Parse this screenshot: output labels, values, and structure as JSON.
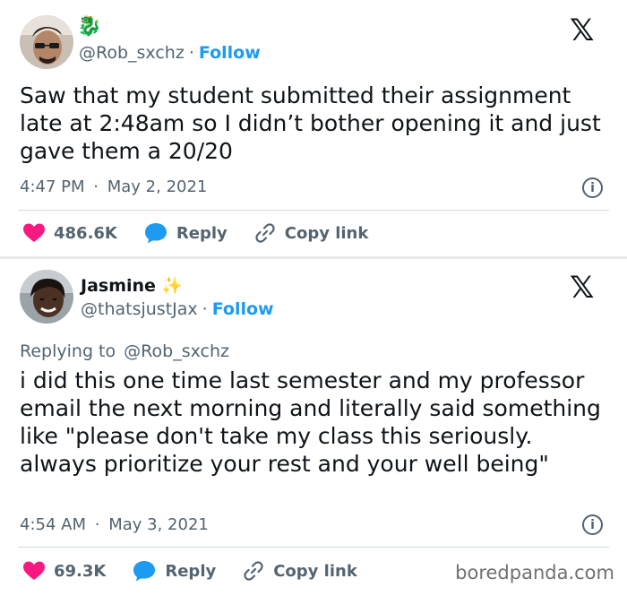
{
  "tweets": [
    {
      "badge_emoji": "🐉",
      "handle": "@Rob_sxchz",
      "separator": "·",
      "follow_label": "Follow",
      "body": "Saw that my student submitted their assignment late at 2:48am so I didn’t bother opening it and just gave them a 20/20",
      "time": "4:47 PM",
      "date": "May 2, 2021",
      "likes": "486.6K",
      "reply_label": "Reply",
      "copy_label": "Copy link"
    },
    {
      "display_name": "Jasmine",
      "sparkle": "✨",
      "handle": "@thatsjustJax",
      "separator": "·",
      "follow_label": "Follow",
      "replying_prefix": "Replying to",
      "replying_handle": "@Rob_sxchz",
      "body": "i did this one time last semester and my professor email the next morning and literally said something like \"please don't take my class this seriously. always prioritize your rest and your well being\"",
      "time": "4:54 AM",
      "date": "May 3, 2021",
      "likes": "69.3K",
      "reply_label": "Reply",
      "copy_label": "Copy link"
    }
  ],
  "logo": "𝕏",
  "watermark": "boredpanda.com",
  "colors": {
    "accent": "#1d9bf0",
    "heart": "#f91880",
    "muted": "#536471"
  }
}
